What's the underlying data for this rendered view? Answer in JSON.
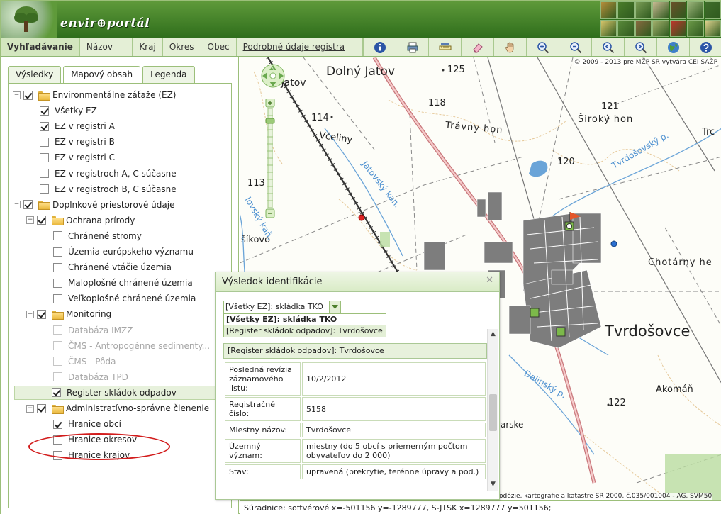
{
  "header": {
    "logo": "envir⊕portál",
    "photo_colors": [
      "#b58c3a",
      "#4a7d2a",
      "#7a9c55",
      "#c7b892",
      "#6b4f2a",
      "#9bb47a",
      "#3f6d2b",
      "#d9c56b",
      "#5a8a3a",
      "#8a6a40",
      "#a3b06d",
      "#c2322b",
      "#6d9a49",
      "#e0d38f"
    ]
  },
  "menu": {
    "items": [
      "Vyhľadávanie",
      "Názov EZ",
      "Kraj",
      "Okres",
      "Obec",
      "Podrobné údaje registra EZ"
    ]
  },
  "toolbar": {
    "icons": [
      "info-icon",
      "print-icon",
      "measure-icon",
      "eraser-icon",
      "hand-icon",
      "zoom-in-icon",
      "zoom-out-icon",
      "zoom-previous-icon",
      "zoom-next-icon",
      "globe-icon",
      "help-icon"
    ]
  },
  "left": {
    "tabs": [
      "Výsledky",
      "Mapový obsah",
      "Legenda"
    ],
    "tree": [
      {
        "label": "Environmentálne záťaže (EZ)",
        "checked": true,
        "folder": true,
        "toggle": "−"
      },
      {
        "label": "Všetky EZ",
        "checked": true
      },
      {
        "label": "EZ v registri A",
        "checked": true
      },
      {
        "label": "EZ v registri B",
        "checked": false
      },
      {
        "label": "EZ v registri C",
        "checked": false
      },
      {
        "label": "EZ v registroch A, C súčasne",
        "checked": false
      },
      {
        "label": "EZ v registroch B, C súčasne",
        "checked": false
      },
      {
        "label": "Doplnkové priestorové údaje",
        "checked": true,
        "folder": true,
        "toggle": "−"
      },
      {
        "label": "Ochrana prírody",
        "checked": true,
        "folder": true,
        "toggle": "−"
      },
      {
        "label": "Chránené stromy",
        "checked": false
      },
      {
        "label": "Územia európskeho významu",
        "checked": false
      },
      {
        "label": "Chránené vtáčie územia",
        "checked": false
      },
      {
        "label": "Maloplošné chránené územia",
        "checked": false
      },
      {
        "label": "Veľkoplošné chránené územia",
        "checked": false
      },
      {
        "label": "Monitoring",
        "checked": true,
        "folder": true,
        "toggle": "−"
      },
      {
        "label": "Databáza IMZZ",
        "checked": false,
        "disabled": true
      },
      {
        "label": "ČMS - Antropogénne sedimenty...",
        "checked": false,
        "disabled": true
      },
      {
        "label": "ČMS - Pôda",
        "checked": false,
        "disabled": true
      },
      {
        "label": "Databáza TPD",
        "checked": false,
        "disabled": true
      },
      {
        "label": "Register skládok odpadov",
        "checked": true,
        "highlight": true
      },
      {
        "label": "Administratívno-správne členenie",
        "checked": true,
        "folder": true,
        "toggle": "−"
      },
      {
        "label": "Hranice obcí",
        "checked": true
      },
      {
        "label": "Hranice okresov",
        "checked": false
      },
      {
        "label": "Hranice krajov",
        "checked": false
      }
    ]
  },
  "map": {
    "copyright_prefix": "© 2009 - 2013 pre ",
    "copyright_link1": "MŽP SR",
    "copyright_mid": " vytvára ",
    "copyright_link2": "CEI SAŽP",
    "nav_north": "N",
    "labels": {
      "dolny_jatov": "Dolný Jatov",
      "z_jatov": "Z. Jatov",
      "n125": "125",
      "n118": "118",
      "n121": "121",
      "siroky_hon": "Široký hon",
      "trc": "Trc",
      "n114": "114",
      "travny_hon": "Trávny hon",
      "vceliny": "Včeliny",
      "jatovsky_kan": "Jatovský kan.",
      "tvrdosovsky_p": "Tvrdošovský p.",
      "n120": "120",
      "n113": "113",
      "lovsky_kan": "lovský kaň.",
      "sikovo": "šíkovo",
      "chotarny_he": "Chotárny he",
      "tvrdosovce": "Tvrdošovce",
      "dalinsky_p": "Dalinský p.",
      "akoman": "Akomáň",
      "n122": "122",
      "arske": "arske"
    },
    "scale_note": "odézie, kartografie a katastre SR 2000, č.035/001004 - AG, SVM50",
    "coords": "Súradnice: softvérové x=-501156 y=-1289777,  S-JTSK x=1289777 y=501156;"
  },
  "popup": {
    "title": "Výsledok identifikácie",
    "select_value": "[Všetky EZ]: skládka TKO",
    "options": [
      "[Všetky EZ]: skládka TKO",
      "[Register skládok odpadov]: Tvrdošovce"
    ],
    "content_header": "[Register skládok odpadov]: Tvrdošovce",
    "rows": [
      {
        "key": "Posledná revízia záznamového listu:",
        "value": "10/2/2012"
      },
      {
        "key": "Registračné číslo:",
        "value": "5158"
      },
      {
        "key": "Miestny názov:",
        "value": "Tvrdošovce"
      },
      {
        "key": "Územný význam:",
        "value": "miestny (do 5 obcí s priemerným počtom obyvateľov do 2 000)"
      },
      {
        "key": "Stav:",
        "value": "upravená (prekrytie, terénne úpravy a pod.)"
      }
    ]
  }
}
